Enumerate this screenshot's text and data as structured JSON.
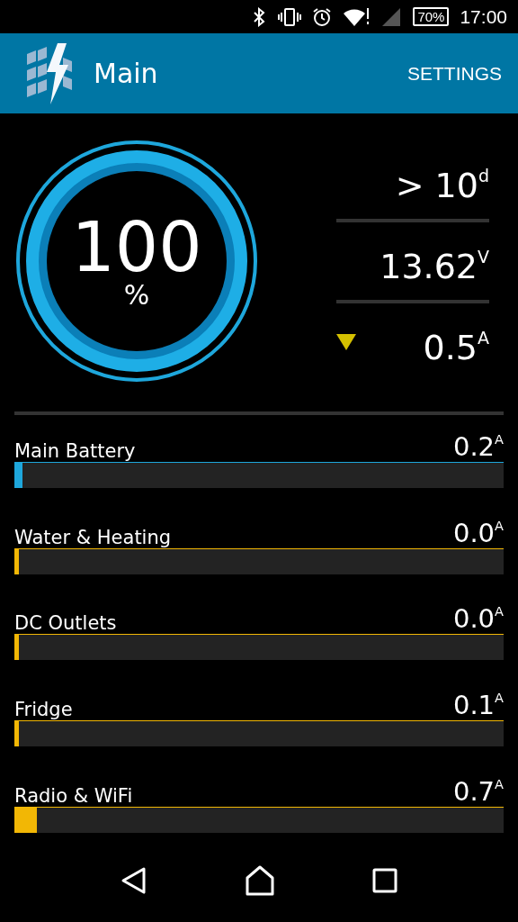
{
  "status_bar": {
    "battery": "70%",
    "time": "17:00"
  },
  "app_bar": {
    "title": "Main",
    "action": "SETTINGS"
  },
  "gauge": {
    "value": "100",
    "unit": "%"
  },
  "readings": [
    {
      "kind": "plain",
      "text": "> 10$^{d}$"
    },
    {
      "kind": "plain",
      "text": "13.62$^{V}$"
    },
    {
      "kind": "trend",
      "text": "0.5$^{A}$"
    }
  ],
  "circuits": [
    {
      "name": "Main Battery",
      "reading": "0.2$^{A}$",
      "level": 0.016,
      "color": "#1ea7dc"
    },
    {
      "name": "Water & Heating",
      "reading": "0.0$^{A}$",
      "level": 0.01,
      "color": "#f2b705"
    },
    {
      "name": "DC Outlets",
      "reading": "0.0$^{A}$",
      "level": 0.01,
      "color": "#f2b705"
    },
    {
      "name": "Fridge",
      "reading": "0.1$^{A}$",
      "level": 0.01,
      "color": "#f2b705"
    },
    {
      "name": "Radio & WiFi",
      "reading": "0.7$^{A}$",
      "level": 0.046,
      "color": "#f2b705"
    }
  ]
}
